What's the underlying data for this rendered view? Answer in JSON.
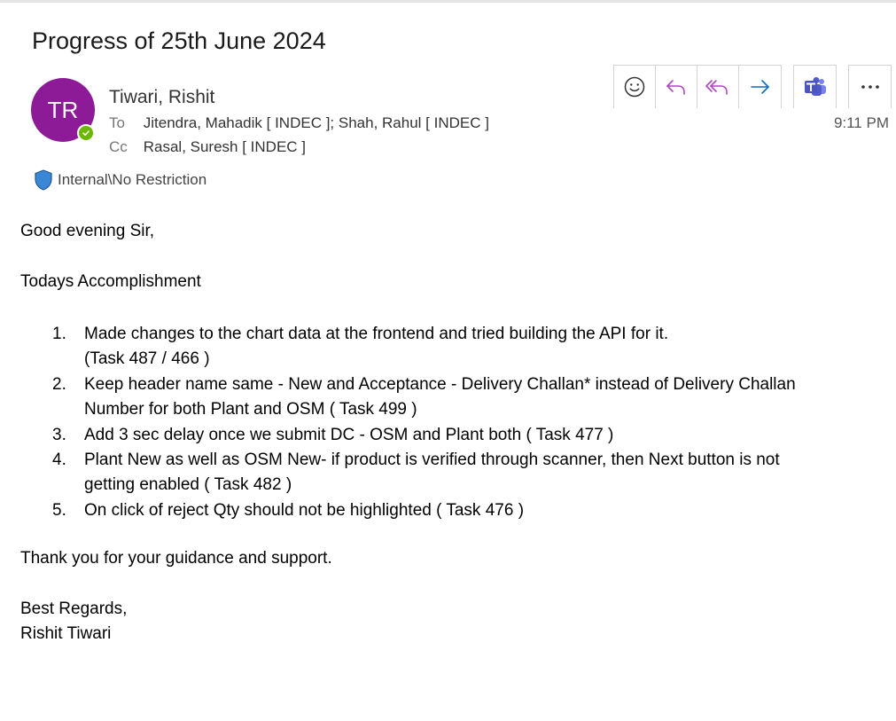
{
  "email": {
    "subject": "Progress of 25th June 2024",
    "avatar_initials": "TR",
    "sender": "Tiwari, Rishit",
    "to_label": "To",
    "to": "Jitendra, Mahadik [ INDEC ]; Shah, Rahul [ INDEC ]",
    "cc_label": "Cc",
    "cc": "Rasal, Suresh [ INDEC ]",
    "time": "9:11 PM",
    "sensitivity": "Internal\\No Restriction"
  },
  "toolbar": {
    "buttons": [
      {
        "icon": "smiley-icon"
      },
      {
        "icon": "reply-icon"
      },
      {
        "icon": "reply-all-icon"
      },
      {
        "icon": "forward-icon"
      },
      {
        "icon": "teams-icon"
      },
      {
        "icon": "more-icon"
      }
    ]
  },
  "body": {
    "greeting": "Good evening Sir,",
    "heading": "Todays Accomplishment",
    "items": [
      {
        "num": "1.",
        "line1": "Made changes to the chart data at the frontend and tried building the API for it.",
        "line2": "(Task 487 / 466 )"
      },
      {
        "num": "2.",
        "line1": "Keep header name same - New and Acceptance - Delivery Challan* instead of Delivery Challan",
        "line2": "Number for both Plant and OSM ( Task 499 )"
      },
      {
        "num": "3.",
        "line1": "Add 3 sec delay once we submit DC - OSM and Plant both ( Task 477 )",
        "line2": ""
      },
      {
        "num": "4.",
        "line1": "Plant New as well as OSM New- if product is verified through scanner, then Next button is not",
        "line2": "getting enabled ( Task 482 )"
      },
      {
        "num": "5.",
        "line1": "On click of reject Qty should not be highlighted ( Task 476 )",
        "line2": ""
      }
    ],
    "thanks": "Thank you for your guidance and support.",
    "regards": "Best Regards,",
    "signature": "Rishit Tiwari"
  },
  "colors": {
    "avatar": "#8d1b97",
    "presence": "#6bb700",
    "action_icon": "#b146c2",
    "forward_icon": "#0f6cbd",
    "teams": "#4b53bc",
    "shield": "#3a87d6"
  }
}
